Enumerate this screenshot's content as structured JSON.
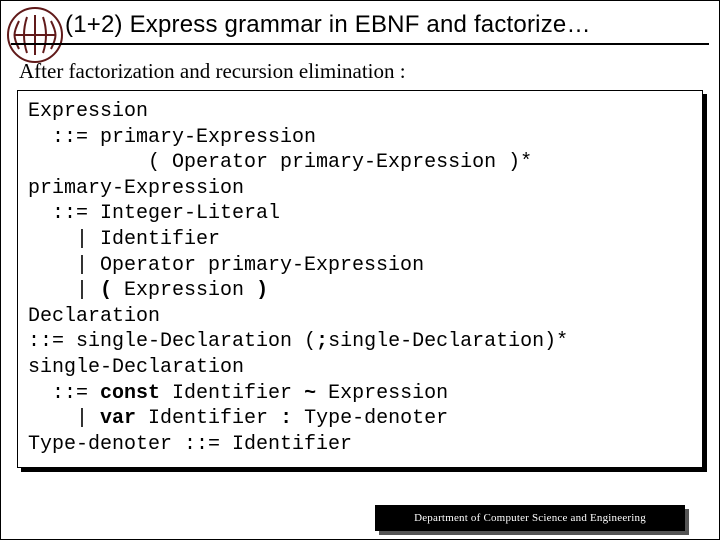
{
  "title": "(1+2) Express grammar in EBNF and factorize…",
  "subtitle": "After factorization and recursion elimination :",
  "grammar": {
    "lines": [
      {
        "t": "Expression"
      },
      {
        "t": "  ::= primary-Expression"
      },
      {
        "t": "          ( Operator primary-Expression )*"
      },
      {
        "t": "primary-Expression"
      },
      {
        "t": "  ::= Integer-Literal"
      },
      {
        "t": "    | Identifier"
      },
      {
        "t": "    | Operator primary-Expression"
      },
      {
        "pre": "    | ",
        "kw1": "(",
        "mid": " Expression ",
        "kw2": ")"
      },
      {
        "t": "Declaration"
      },
      {
        "pre": "::= single-Declaration (",
        "kw1": ";",
        "post": "single-Declaration)*"
      },
      {
        "t": "single-Declaration"
      },
      {
        "pre": "  ::= ",
        "kw1": "const",
        "mid": " Identifier ",
        "kw2": "~",
        "post": " Expression"
      },
      {
        "pre": "    | ",
        "kw1": "var",
        "mid": " Identifier ",
        "kw2": ":",
        "post": " Type-denoter"
      },
      {
        "t": "Type-denoter ::= Identifier"
      }
    ]
  },
  "footer": "Department of Computer Science and Engineering",
  "logo": {
    "name": "university-seal-icon",
    "primary_color": "#611a1a"
  }
}
